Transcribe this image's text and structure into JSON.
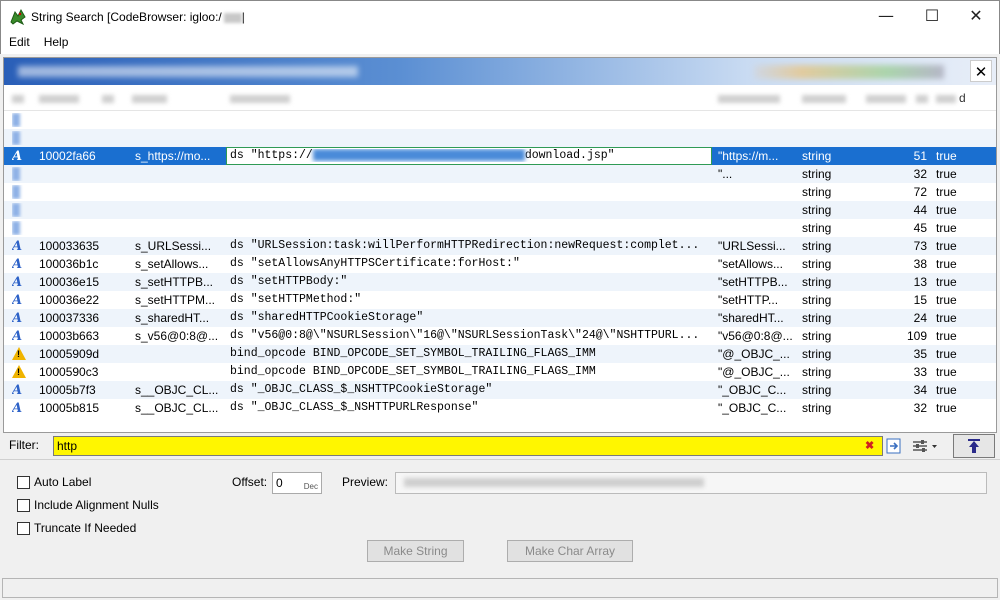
{
  "window": {
    "title": "String Search [CodeBrowser: igloo:/",
    "minimize": "—",
    "maximize": "☐",
    "close": "✕"
  },
  "menu": [
    "Edit",
    "Help"
  ],
  "panel": {
    "close": "✕",
    "last_column_header": "d"
  },
  "rows": [
    {
      "icon": "blurred",
      "blurred": true,
      "len": "",
      "ok": ""
    },
    {
      "icon": "blurred",
      "blurred": true,
      "len": "",
      "ok": ""
    },
    {
      "icon": "string-icon",
      "selected": true,
      "addr": "10002fa66",
      "label": "s_https://mo...",
      "code_pre": "ds \"https://",
      "code_post": "download.jsp\"",
      "value": "\"https://m...",
      "type": "string",
      "len": "51",
      "ok": "true"
    },
    {
      "icon": "blurred",
      "blurred": true,
      "value": "\"...",
      "type": "string",
      "len": "32",
      "ok": "true"
    },
    {
      "icon": "blurred",
      "blurred": true,
      "type": "string",
      "len": "72",
      "ok": "true"
    },
    {
      "icon": "blurred",
      "blurred": true,
      "type": "string",
      "len": "44",
      "ok": "true"
    },
    {
      "icon": "blurred",
      "blurred": true,
      "type": "string",
      "len": "45",
      "ok": "true"
    },
    {
      "icon": "string-icon",
      "addr": "100033635",
      "label": "s_URLSessi...",
      "code": "ds \"URLSession:task:willPerformHTTPRedirection:newRequest:complet...",
      "value": "\"URLSessi...",
      "type": "string",
      "len": "73",
      "ok": "true"
    },
    {
      "icon": "string-icon",
      "addr": "100036b1c",
      "label": "s_setAllows...",
      "code": "ds \"setAllowsAnyHTTPSCertificate:forHost:\"",
      "value": "\"setAllows...",
      "type": "string",
      "len": "38",
      "ok": "true"
    },
    {
      "icon": "string-icon",
      "addr": "100036e15",
      "label": "s_setHTTPB...",
      "code": "ds \"setHTTPBody:\"",
      "value": "\"setHTTPB...",
      "type": "string",
      "len": "13",
      "ok": "true"
    },
    {
      "icon": "string-icon",
      "addr": "100036e22",
      "label": "s_setHTTPM...",
      "code": "ds \"setHTTPMethod:\"",
      "value": "\"setHTTP...",
      "type": "string",
      "len": "15",
      "ok": "true"
    },
    {
      "icon": "string-icon",
      "addr": "100037336",
      "label": "s_sharedHT...",
      "code": "ds \"sharedHTTPCookieStorage\"",
      "value": "\"sharedHT...",
      "type": "string",
      "len": "24",
      "ok": "true"
    },
    {
      "icon": "string-icon",
      "addr": "10003b663",
      "label": "s_v56@0:8@...",
      "code": "ds \"v56@0:8@\\\"NSURLSession\\\"16@\\\"NSURLSessionTask\\\"24@\\\"NSHTTPURL...",
      "value": "\"v56@0:8@...",
      "type": "string",
      "len": "109",
      "ok": "true"
    },
    {
      "icon": "warning-icon",
      "addr": "10005909d",
      "label": "",
      "code": "bind_opcode BIND_OPCODE_SET_SYMBOL_TRAILING_FLAGS_IMM",
      "value": "\"@_OBJC_...",
      "type": "string",
      "len": "35",
      "ok": "true"
    },
    {
      "icon": "warning-icon",
      "addr": "1000590c3",
      "label": "",
      "code": "bind_opcode BIND_OPCODE_SET_SYMBOL_TRAILING_FLAGS_IMM",
      "value": "\"@_OBJC_...",
      "type": "string",
      "len": "33",
      "ok": "true"
    },
    {
      "icon": "string-icon",
      "addr": "10005b7f3",
      "label": "s__OBJC_CL...",
      "code": "ds \"_OBJC_CLASS_$_NSHTTPCookieStorage\"",
      "value": "\"_OBJC_C...",
      "type": "string",
      "len": "34",
      "ok": "true"
    },
    {
      "icon": "string-icon",
      "addr": "10005b815",
      "label": "s__OBJC_CL...",
      "code": "ds \"_OBJC_CLASS_$_NSHTTPURLResponse\"",
      "value": "\"_OBJC_C...",
      "type": "string",
      "len": "32",
      "ok": "true"
    }
  ],
  "filter": {
    "label": "Filter:",
    "value": "http",
    "clear": "✖"
  },
  "options": {
    "auto_label": "Auto Label",
    "include_alignment_nulls": "Include Alignment Nulls",
    "truncate_if_needed": "Truncate If Needed",
    "offset_label": "Offset:",
    "offset_value": "0",
    "offset_radix": "Dec",
    "preview_label": "Preview:",
    "make_string": "Make String",
    "make_char_array": "Make Char Array"
  },
  "colors": {
    "selection": "#1a6fd0",
    "filter_bg": "#fff600",
    "string_icon": "#2d62c8",
    "warning_icon": "#f0b400"
  }
}
